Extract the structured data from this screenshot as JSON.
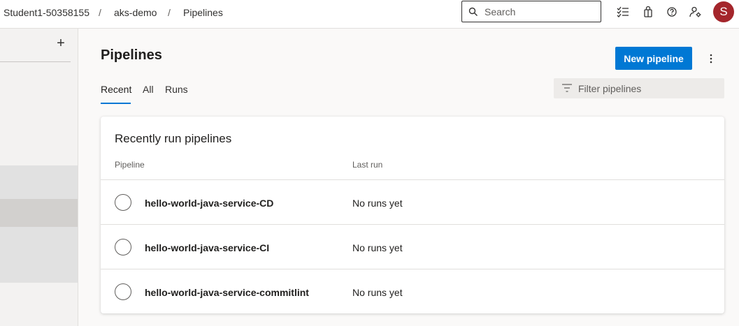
{
  "breadcrumb": {
    "organization": "Student1-50358155",
    "project": "aks-demo",
    "page": "Pipelines",
    "separator": "/"
  },
  "search": {
    "placeholder": "Search"
  },
  "topbar_icons": [
    "checklist-icon",
    "shopping-bag-icon",
    "help-icon",
    "user-settings-icon"
  ],
  "user": {
    "initial": "S",
    "avatar_color": "#a4262c"
  },
  "sidebar": {
    "add_label": "+"
  },
  "main": {
    "title": "Pipelines",
    "new_pipeline_label": "New pipeline",
    "tabs": [
      {
        "label": "Recent",
        "active": true
      },
      {
        "label": "All",
        "active": false
      },
      {
        "label": "Runs",
        "active": false
      }
    ],
    "filter_placeholder": "Filter pipelines"
  },
  "recent": {
    "title": "Recently run pipelines",
    "columns": {
      "pipeline": "Pipeline",
      "last_run": "Last run"
    },
    "rows": [
      {
        "name": "hello-world-java-service-CD",
        "last_run": "No runs yet"
      },
      {
        "name": "hello-world-java-service-CI",
        "last_run": "No runs yet"
      },
      {
        "name": "hello-world-java-service-commitlint",
        "last_run": "No runs yet"
      }
    ]
  },
  "colors": {
    "accent": "#0078d4",
    "avatar": "#a4262c"
  }
}
